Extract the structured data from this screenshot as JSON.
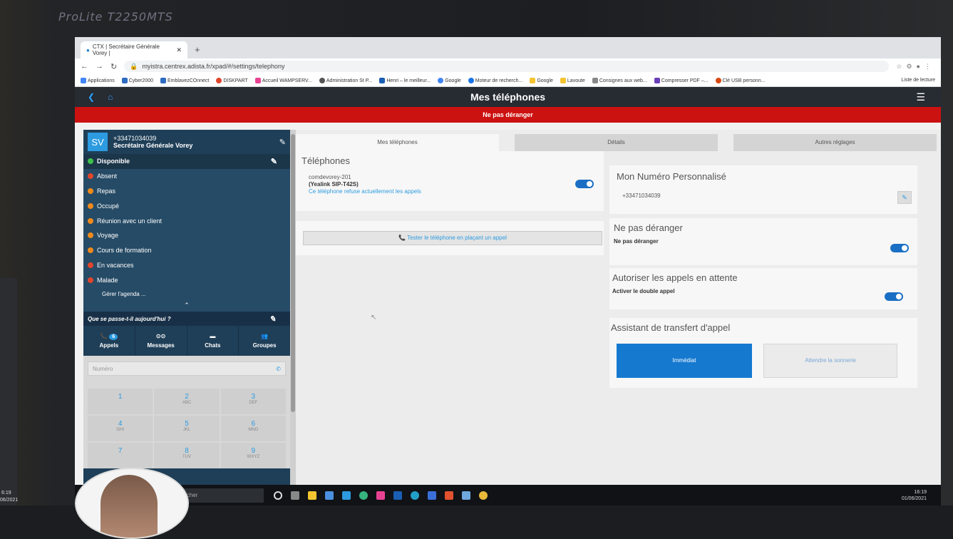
{
  "monitor": {
    "brand": "ProLite T2250MTS"
  },
  "browser": {
    "tab_title": "CTX | Secrétaire Générale Vorey |",
    "new_tab": "+",
    "url": "myistra.centrex.adista.fr/xpad/#/settings/telephony",
    "bookmarks": [
      "Applications",
      "Cyber2000",
      "EmblavezCOnnect",
      "DISKPART",
      "Accueil WAMPSERV...",
      "Administration St P...",
      "Henri – le meilleur...",
      "Google",
      "Moteur de recherch...",
      "Google",
      "Lavoute",
      "Consignes aux web...",
      "Compresser PDF –...",
      "Clé USB personn...",
      "Liste de lecture"
    ]
  },
  "header": {
    "title": "Mes téléphones",
    "banner": "Ne pas déranger"
  },
  "user": {
    "initials": "SV",
    "number": "+33471034039",
    "name": "Secrétaire Générale Vorey"
  },
  "statuses": [
    {
      "label": "Disponible",
      "color": "#3cc24a"
    },
    {
      "label": "Absent",
      "color": "#e0452b"
    },
    {
      "label": "Repas",
      "color": "#f08a1c"
    },
    {
      "label": "Occupé",
      "color": "#f08a1c"
    },
    {
      "label": "Réunion avec un client",
      "color": "#f08a1c"
    },
    {
      "label": "Voyage",
      "color": "#f08a1c"
    },
    {
      "label": "Cours de formation",
      "color": "#f08a1c"
    },
    {
      "label": "En vacances",
      "color": "#e0452b"
    },
    {
      "label": "Malade",
      "color": "#e0452b"
    }
  ],
  "agenda": "Gérer l'agenda ...",
  "today_prompt": "Que se passe-t-il aujourd'hui ?",
  "tabs": {
    "calls": "Appels",
    "calls_badge": "6",
    "messages": "Messages",
    "chats": "Chats",
    "groups": "Groupes"
  },
  "dialpad": {
    "placeholder": "Numéro",
    "keys": [
      {
        "n": "1",
        "s": ""
      },
      {
        "n": "2",
        "s": "ABC"
      },
      {
        "n": "3",
        "s": "DEF"
      },
      {
        "n": "4",
        "s": "GHI"
      },
      {
        "n": "5",
        "s": "JKL"
      },
      {
        "n": "6",
        "s": "MNO"
      },
      {
        "n": "7",
        "s": ""
      },
      {
        "n": "8",
        "s": "TUV"
      },
      {
        "n": "9",
        "s": "WXYZ"
      }
    ]
  },
  "content_tabs": [
    "Mes téléphones",
    "Détails",
    "Autres réglages"
  ],
  "phones": {
    "title": "Téléphones",
    "device_id": "comdevorey-201",
    "device_model": "(Yealink SIP-T42S)",
    "device_status": "Ce téléphone refuse actuellement les appels",
    "device_enabled": true,
    "test_button": "Tester le téléphone en plaçant un appel"
  },
  "personal_number": {
    "title": "Mon Numéro Personnalisé",
    "value": "+33471034039"
  },
  "dnd": {
    "title": "Ne pas déranger",
    "label": "Ne pas déranger",
    "enabled": true
  },
  "call_waiting": {
    "title": "Autoriser les appels en attente",
    "label": "Activer le double appel",
    "enabled": true
  },
  "transfer": {
    "title": "Assistant de transfert d'appel",
    "immediate": "Immédiat",
    "ring": "Attendre la sonnerie"
  },
  "taskbar": {
    "search": "Rechercher",
    "time": "16:19",
    "date": "01/06/2021"
  },
  "left_edge": {
    "time": "6:19",
    "date": "06/2021"
  },
  "colors": {
    "accent": "#1579d0",
    "banner": "#cc1111",
    "sidebar": "#1f3f58"
  }
}
